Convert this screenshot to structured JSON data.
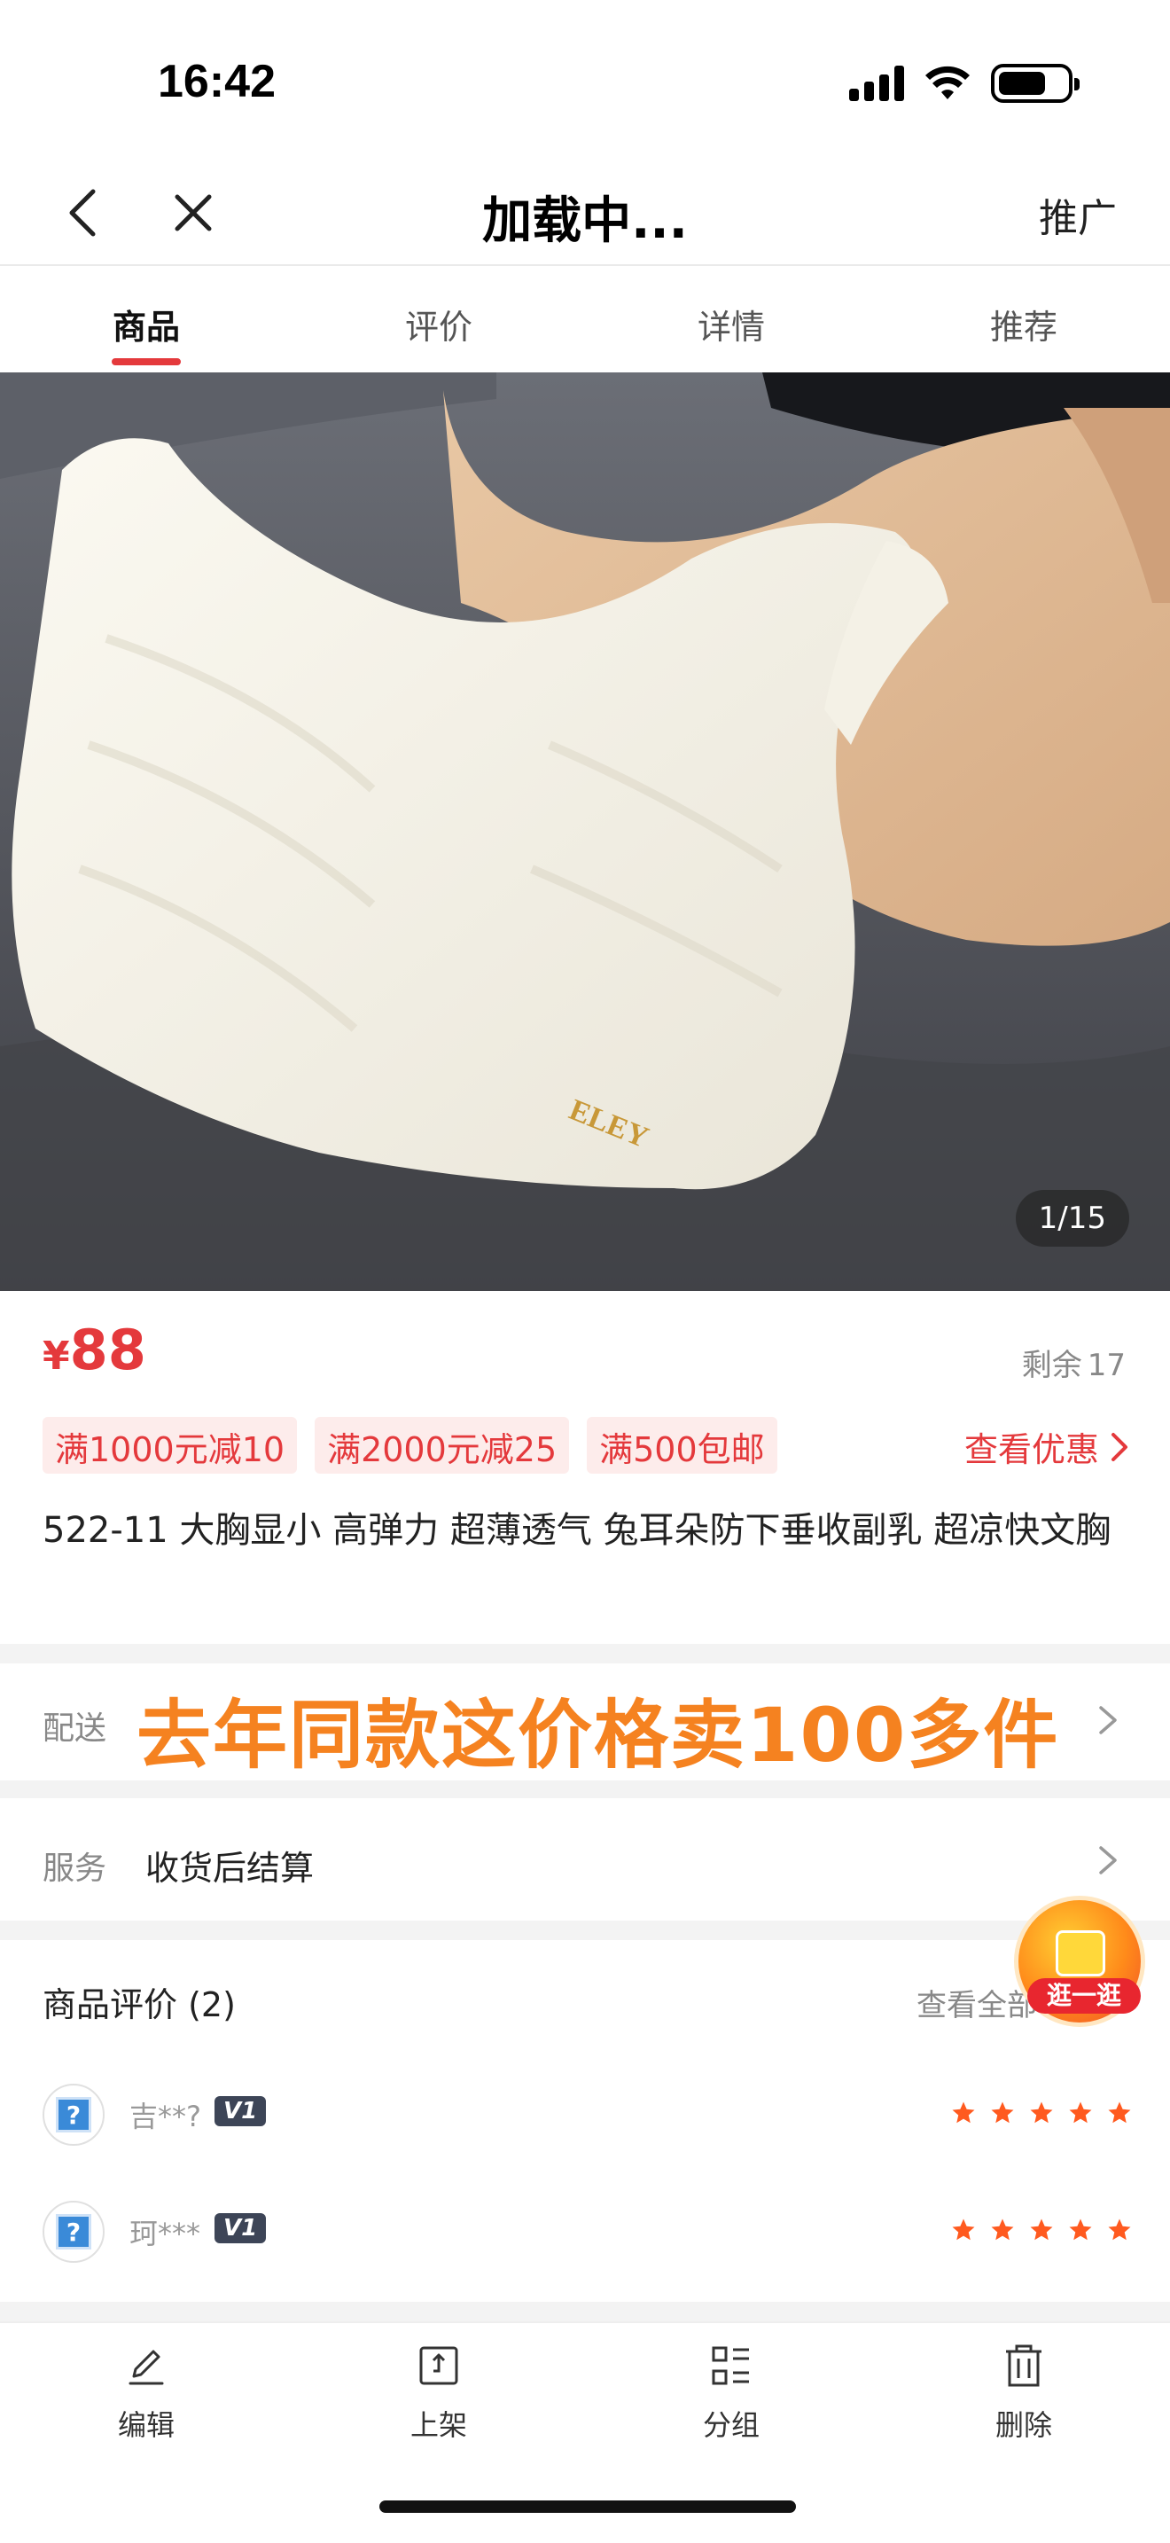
{
  "status_bar": {
    "time": "16:42"
  },
  "nav": {
    "title": "加载中...",
    "promo_label": "推广"
  },
  "tabs": [
    {
      "label": "商品",
      "active": true
    },
    {
      "label": "评价",
      "active": false
    },
    {
      "label": "详情",
      "active": false
    },
    {
      "label": "推荐",
      "active": false
    }
  ],
  "product_image": {
    "brand_text": "ELEY",
    "counter": "1/15"
  },
  "price": {
    "currency": "¥",
    "value": "88"
  },
  "stock": {
    "label": "剩余",
    "count": "17"
  },
  "coupons": [
    "满1000元减10",
    "满2000元减25",
    "满500包邮"
  ],
  "see_discount_label": "查看优惠",
  "product_title": "522-11 大胸显小 高弹力 超薄透气 兔耳朵防下垂收副乳 超凉快文胸",
  "delivery": {
    "label": "配送",
    "overlay_text": "去年同款这价格卖100多件"
  },
  "service": {
    "label": "服务",
    "value": "收货后结算"
  },
  "reviews": {
    "title": "商品评价 (2)",
    "more_label": "查看全部",
    "items": [
      {
        "name": "吉**?",
        "level": "V1",
        "stars": 5
      },
      {
        "name": "珂***",
        "level": "V1",
        "stars": 5
      }
    ]
  },
  "float_badge": {
    "label": "逛一逛"
  },
  "toolbar": [
    {
      "label": "编辑",
      "icon": "edit-icon"
    },
    {
      "label": "上架",
      "icon": "shelf-up-icon"
    },
    {
      "label": "分组",
      "icon": "group-icon"
    },
    {
      "label": "删除",
      "icon": "trash-icon"
    }
  ],
  "colors": {
    "accent": "#e4393c",
    "overlay": "#f58220",
    "star": "#ff5a1f"
  }
}
